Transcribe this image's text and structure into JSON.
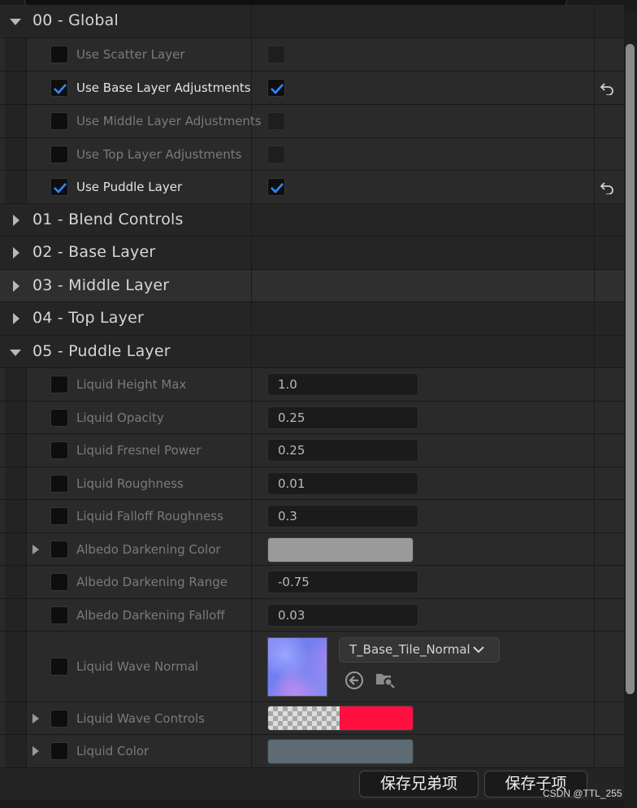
{
  "categories": [
    {
      "title": "00 - Global",
      "expanded": true
    },
    {
      "title": "01 - Blend Controls",
      "expanded": false
    },
    {
      "title": "02 - Base Layer",
      "expanded": false
    },
    {
      "title": "03 - Middle Layer",
      "expanded": false
    },
    {
      "title": "04 - Top Layer",
      "expanded": false
    },
    {
      "title": "05 - Puddle Layer",
      "expanded": true
    }
  ],
  "global_props": [
    {
      "label": "Use Scatter Layer",
      "override": false,
      "value": false
    },
    {
      "label": "Use Base Layer Adjustments",
      "override": true,
      "value": true
    },
    {
      "label": "Use Middle Layer Adjustments",
      "override": false,
      "value": false
    },
    {
      "label": "Use Top Layer Adjustments",
      "override": false,
      "value": false
    },
    {
      "label": "Use Puddle Layer",
      "override": true,
      "value": true
    }
  ],
  "puddle_props": [
    {
      "label": "Liquid Height Max",
      "value": "1.0"
    },
    {
      "label": "Liquid Opacity",
      "value": "0.25"
    },
    {
      "label": "Liquid Fresnel Power",
      "value": "0.25"
    },
    {
      "label": "Liquid Roughness",
      "value": "0.01"
    },
    {
      "label": "Liquid Falloff Roughness",
      "value": "0.3"
    },
    {
      "label": "Albedo Darkening Color",
      "color": "#9a9a9a"
    },
    {
      "label": "Albedo Darkening Range",
      "value": "-0.75"
    },
    {
      "label": "Albedo Darkening Falloff",
      "value": "0.03"
    },
    {
      "label": "Liquid Wave Normal",
      "asset": "T_Base_Tile_Normal"
    },
    {
      "label": "Liquid Wave Controls",
      "color": "#ff1040"
    },
    {
      "label": "Liquid Color",
      "color": "#5d6b73"
    }
  ],
  "buttons": {
    "save_siblings": "保存兄弟项",
    "save_children": "保存子项"
  },
  "watermark": "CSDN @TTL_255",
  "colors": {
    "check": "#2f8bff",
    "accent_red": "#ff1040"
  }
}
